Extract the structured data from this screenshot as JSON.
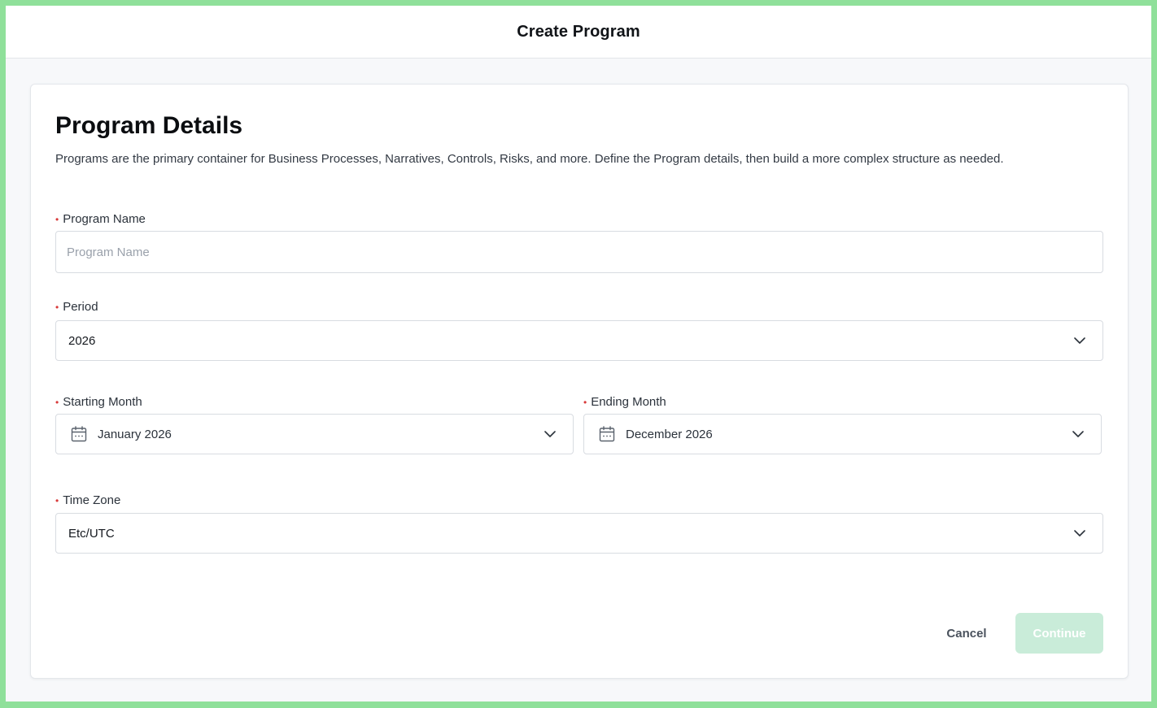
{
  "header": {
    "title": "Create Program"
  },
  "card": {
    "title": "Program Details",
    "description": "Programs are the primary container for Business Processes, Narratives, Controls, Risks, and more. Define the Program details, then build a more complex structure as needed."
  },
  "form": {
    "required_marker": "•",
    "program_name": {
      "label": "Program Name",
      "placeholder": "Program Name",
      "value": ""
    },
    "period": {
      "label": "Period",
      "value": "2026"
    },
    "starting_month": {
      "label": "Starting Month",
      "value": "January 2026"
    },
    "ending_month": {
      "label": "Ending Month",
      "value": "December 2026"
    },
    "time_zone": {
      "label": "Time Zone",
      "value": "Etc/UTC"
    }
  },
  "actions": {
    "cancel_label": "Cancel",
    "continue_label": "Continue"
  },
  "icons": {
    "calendar": "calendar-icon",
    "chevron": "chevron-down-icon"
  },
  "colors": {
    "frame": "#8fe09a",
    "required": "#d83a3a",
    "continue_disabled": "#c9ecd9"
  }
}
